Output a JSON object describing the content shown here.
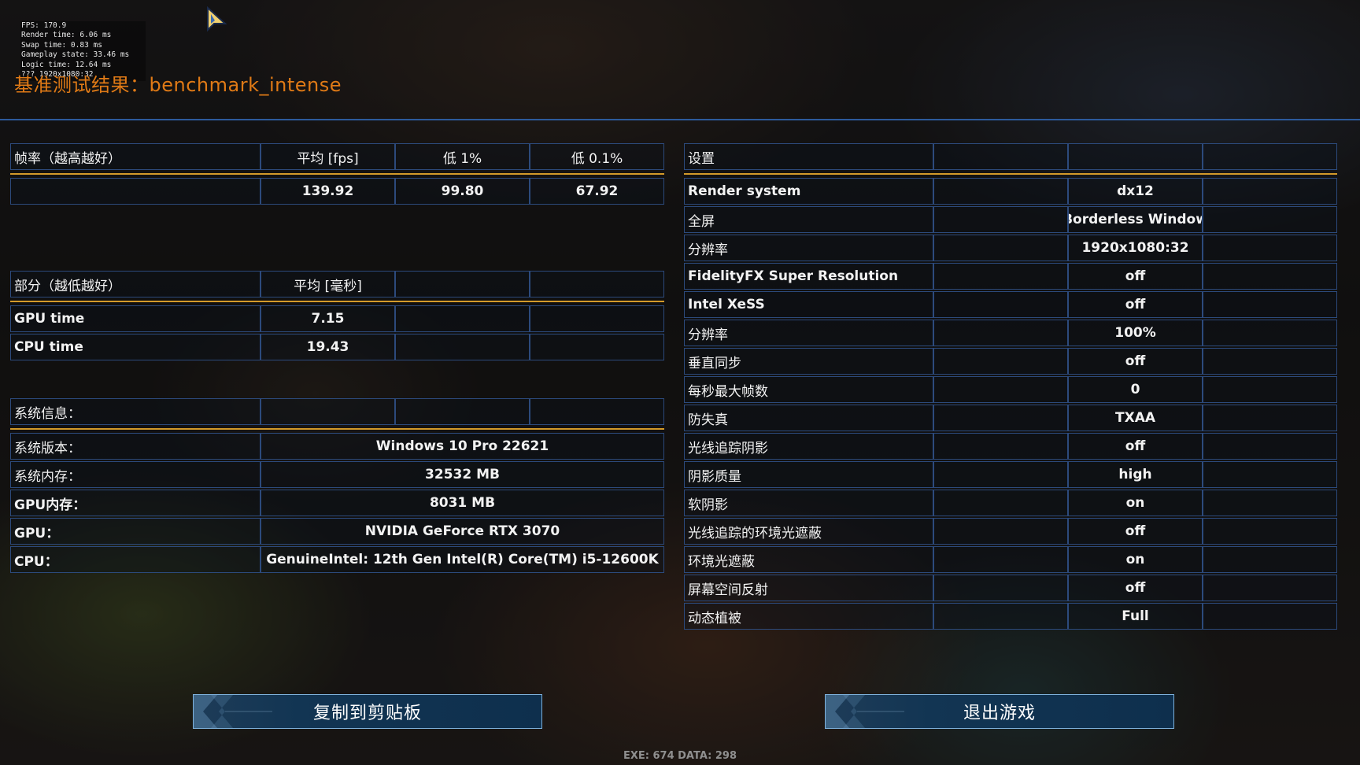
{
  "overlay_stats": {
    "fps": "FPS: 170.9",
    "render_time": "Render time: 6.06 ms",
    "swap_time": "Swap time: 0.83 ms",
    "gameplay_state": "Gameplay state: 33.46 ms",
    "logic_time": "Logic time: 12.64 ms",
    "resolution": "??? 1920x1080:32"
  },
  "title": "基准测试结果：benchmark_intense",
  "framerate_table": {
    "headers": [
      "帧率（越高越好）",
      "平均 [fps]",
      "低 1%",
      "低 0.1%"
    ],
    "values": [
      "",
      "139.92",
      "99.80",
      "67.92"
    ]
  },
  "parts_table": {
    "headers": [
      "部分（越低越好）",
      "平均 [毫秒]",
      "",
      ""
    ],
    "rows": [
      [
        "GPU time",
        "7.15"
      ],
      [
        "CPU time",
        "19.43"
      ]
    ]
  },
  "system_table": {
    "header": "系统信息：",
    "rows": [
      [
        "系统版本：",
        "Windows 10 Pro 22621"
      ],
      [
        "系统内存：",
        "32532 MB"
      ],
      [
        "GPU内存：",
        "8031 MB"
      ],
      [
        "GPU：",
        "NVIDIA GeForce RTX 3070"
      ],
      [
        "CPU：",
        "GenuineIntel: 12th Gen Intel(R) Core(TM) i5-12600K"
      ]
    ]
  },
  "settings_table": {
    "header": "设置",
    "rows": [
      [
        "Render system",
        "dx12"
      ],
      [
        "全屏",
        "Borderless Window"
      ],
      [
        "分辨率",
        "1920x1080:32"
      ],
      [
        "FidelityFX Super Resolution",
        "off"
      ],
      [
        "Intel XeSS",
        "off"
      ],
      [
        "分辨率",
        "100%"
      ],
      [
        "垂直同步",
        "off"
      ],
      [
        "每秒最大帧数",
        "0"
      ],
      [
        "防失真",
        "TXAA"
      ],
      [
        "光线追踪阴影",
        "off"
      ],
      [
        "阴影质量",
        "high"
      ],
      [
        "软阴影",
        "on"
      ],
      [
        "光线追踪的环境光遮蔽",
        "off"
      ],
      [
        "环境光遮蔽",
        "on"
      ],
      [
        "屏幕空间反射",
        "off"
      ],
      [
        "动态植被",
        "Full"
      ]
    ]
  },
  "buttons": {
    "copy": "复制到剪贴板",
    "exit": "退出游戏"
  },
  "footer": "EXE: 674 DATA: 298",
  "colors": {
    "title": "#e07a16",
    "accent_line": "#d39a2a",
    "border": "#2c4a7c",
    "rule": "#2c5a9c"
  }
}
